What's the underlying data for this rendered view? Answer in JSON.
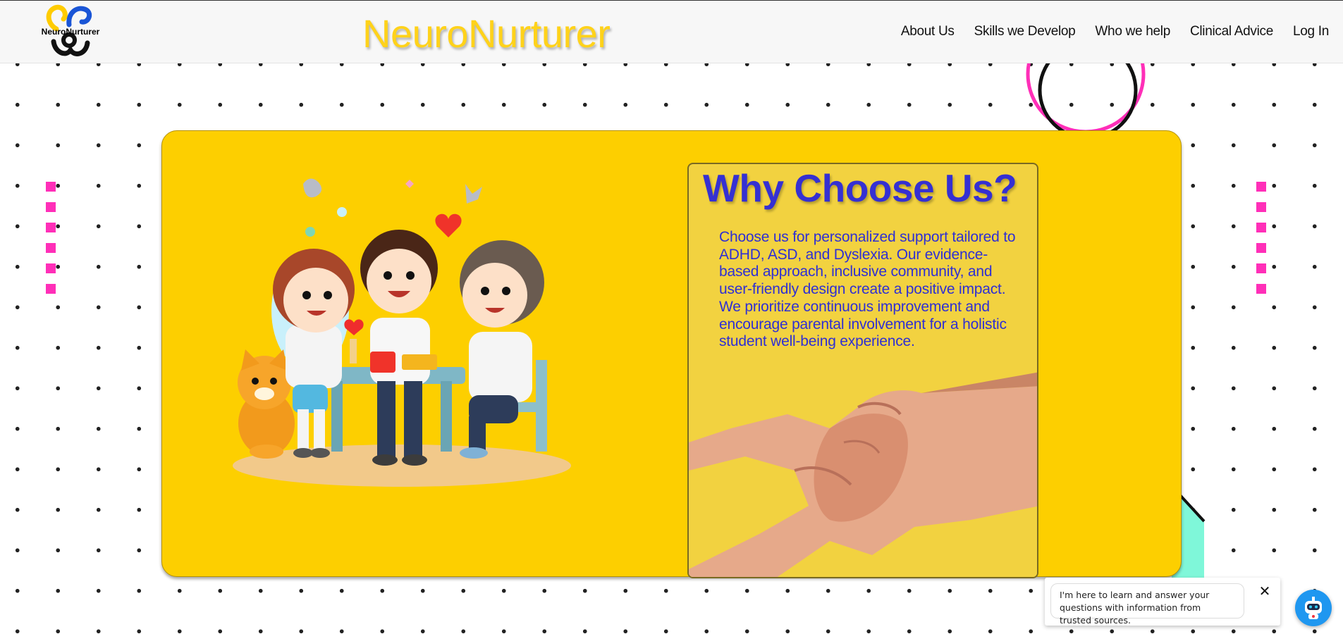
{
  "header": {
    "logo_text": "NeuroNurturer",
    "brand": "NeuroNurturer",
    "nav": [
      {
        "label": "About Us"
      },
      {
        "label": "Skills we Develop"
      },
      {
        "label": "Who we help"
      },
      {
        "label": "Clinical Advice"
      },
      {
        "label": "Log In"
      }
    ]
  },
  "card": {
    "title": "Why Choose Us?",
    "body": "Choose us for personalized support tailored to ADHD, ASD, and Dyslexia. Our evidence-based approach, inclusive community, and user-friendly design create a positive impact. We prioritize continuous improvement and encourage parental involvement for a holistic student well-being experience."
  },
  "chat": {
    "message": "I'm here to learn and answer your questions with information from trusted sources.",
    "close_icon": "close-icon",
    "bot_icon": "robot-icon"
  },
  "colors": {
    "brand_yellow": "#ffd21a",
    "card_yellow": "#fdcf00",
    "title_blue": "#3530d2",
    "accent_pink": "#ff2fb8",
    "chat_blue": "#1f97f0"
  }
}
